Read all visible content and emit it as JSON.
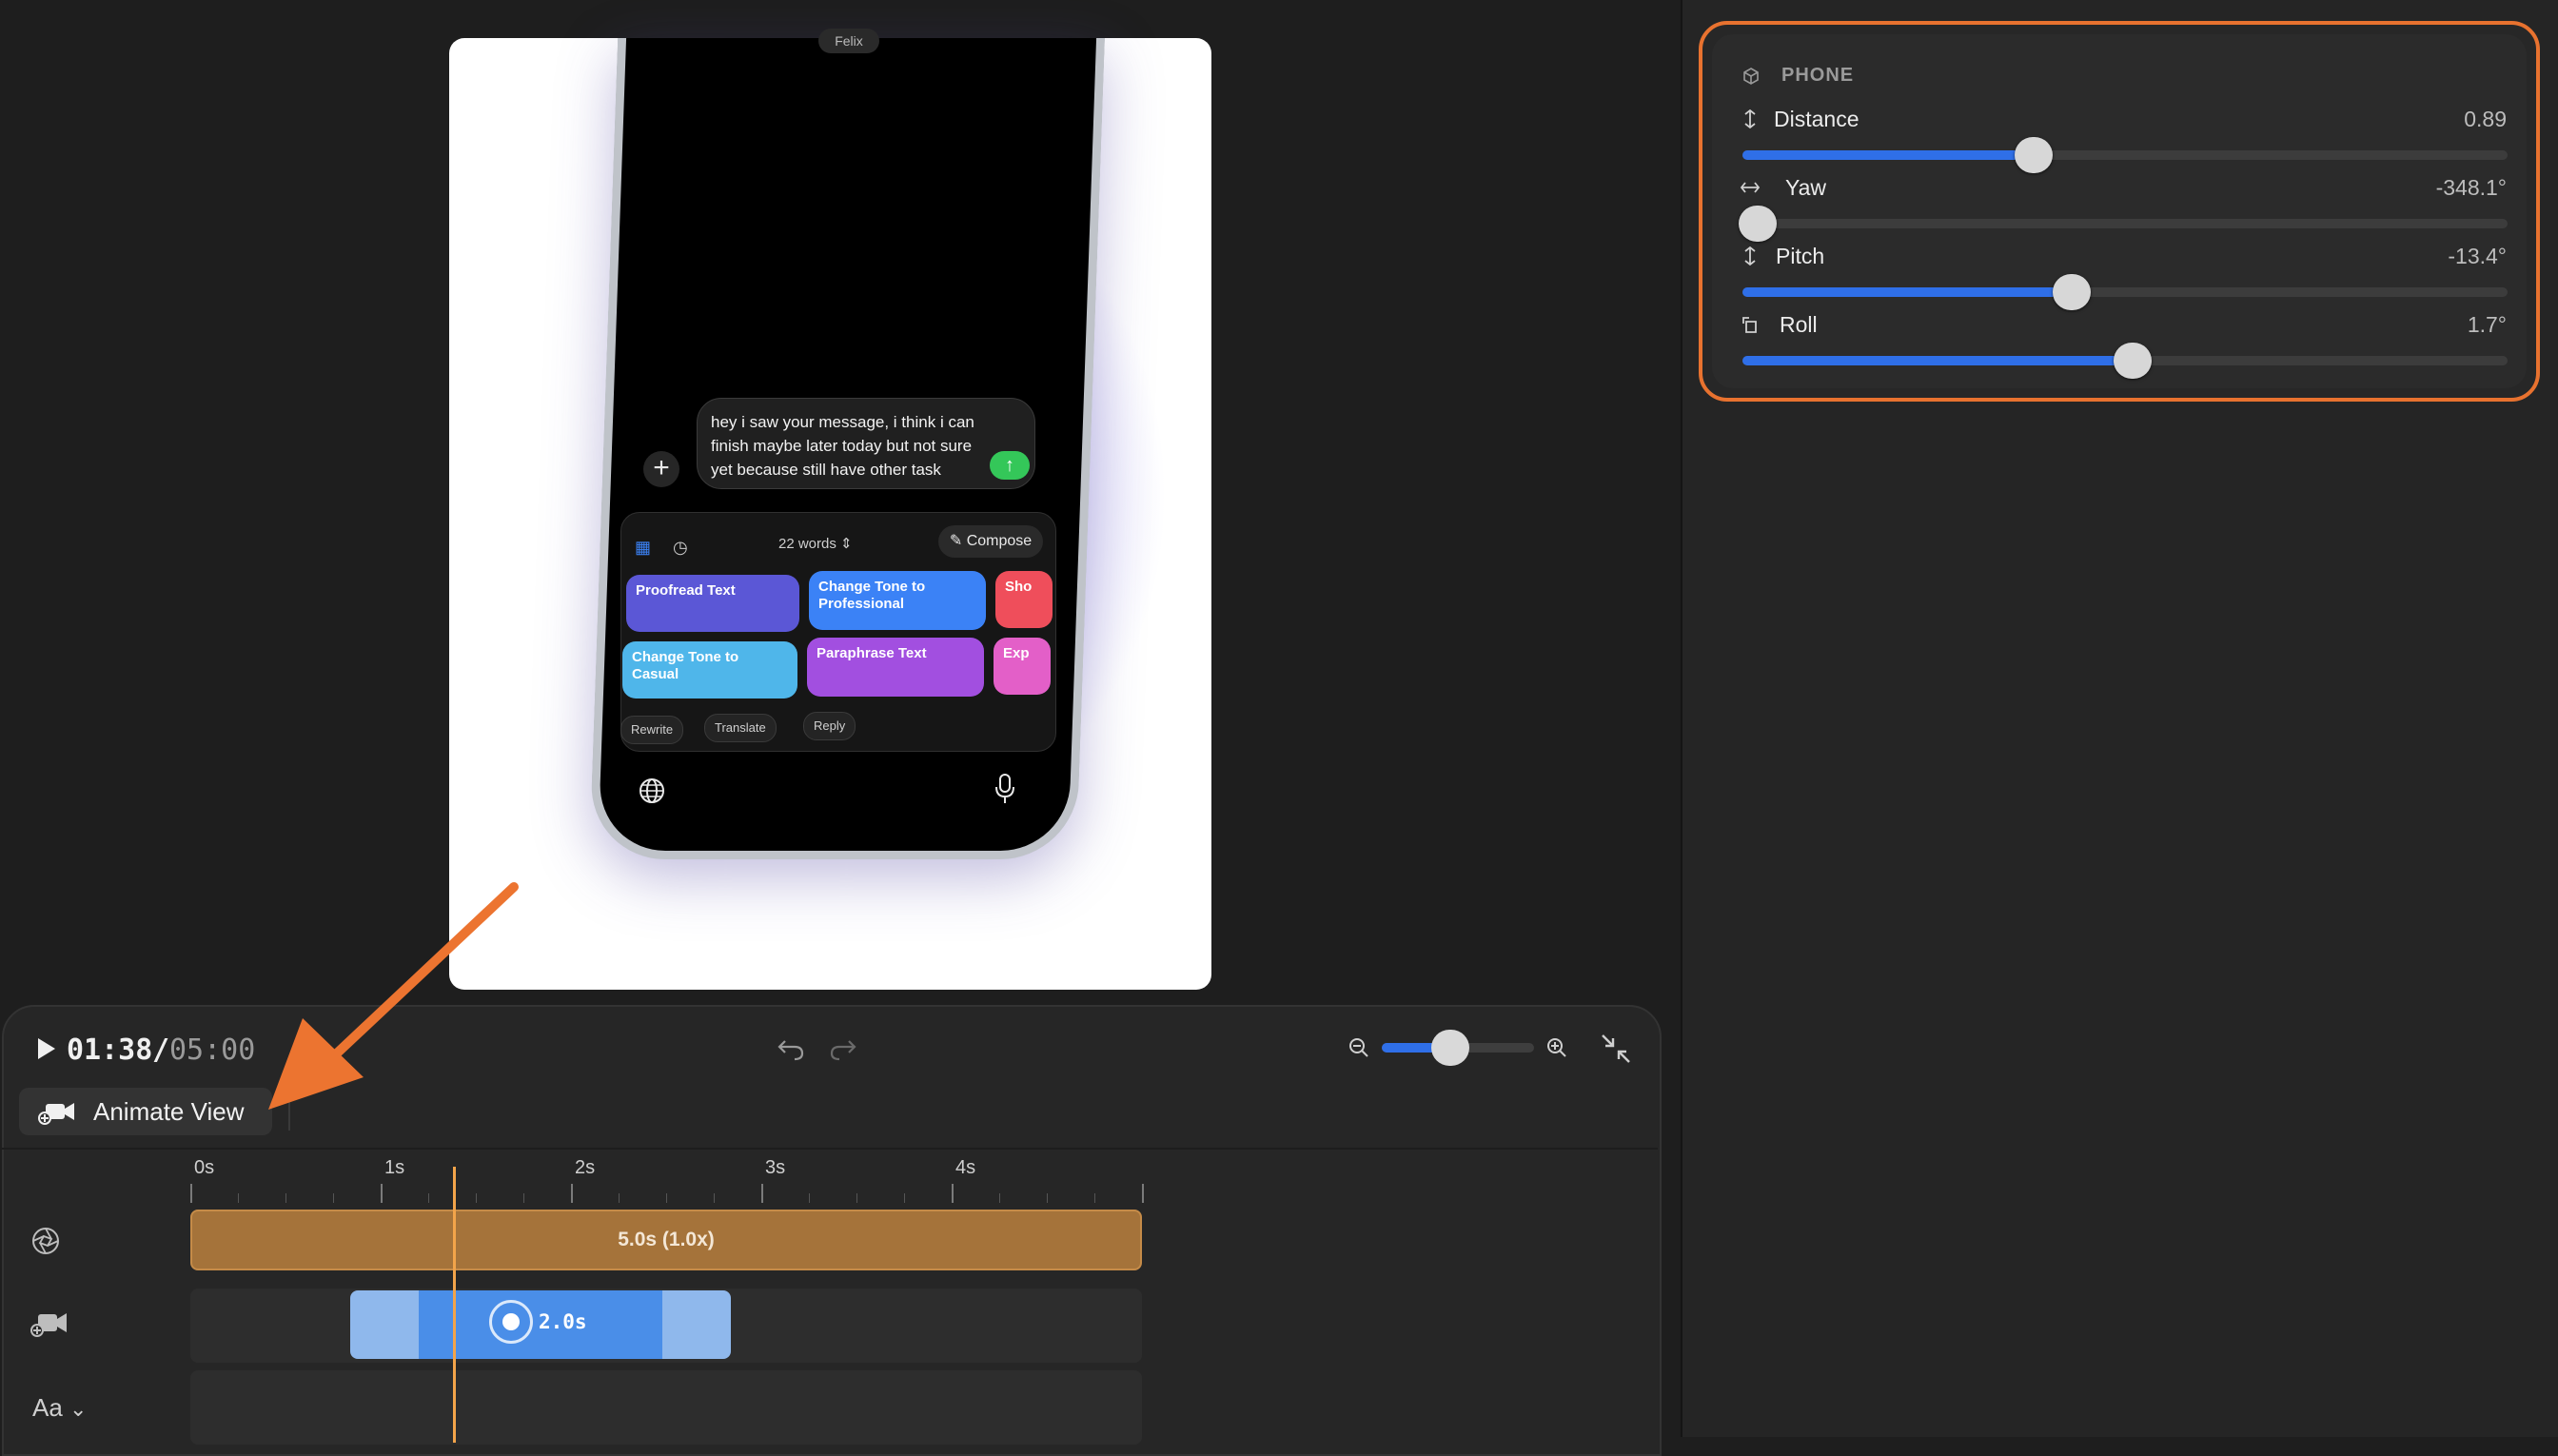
{
  "inspector": {
    "section_title": "PHONE",
    "props": [
      {
        "label": "Distance",
        "value": "0.89",
        "level": 0.38
      },
      {
        "label": "Yaw",
        "value": "-348.1°",
        "level": 0.02
      },
      {
        "label": "Pitch",
        "value": "-13.4°",
        "level": 0.43
      },
      {
        "label": "Roll",
        "value": "1.7°",
        "level": 0.51
      }
    ]
  },
  "preview": {
    "notch_label": "Felix",
    "message_text": "hey i saw your message, i think i can finish maybe later today but not sure yet because still have other task",
    "word_count": "22 words",
    "compose_label": "Compose",
    "actions": [
      {
        "label": "Proofread Text",
        "color": "#5b57d6"
      },
      {
        "label": "Change Tone to Professional",
        "color": "#3b82f6"
      },
      {
        "label": "Sho",
        "color": "#ef4e5b"
      },
      {
        "label": "Change Tone to Casual",
        "color": "#4fb6ea"
      },
      {
        "label": "Paraphrase Text",
        "color": "#a24fe0"
      },
      {
        "label": "Exp",
        "color": "#e35fc8"
      }
    ],
    "chips": [
      "Rewrite",
      "Translate",
      "Reply"
    ]
  },
  "timeline": {
    "time_current": "01:38",
    "time_separator": "/",
    "time_total": "05:00",
    "animate_button_label": "Animate View",
    "ticks": [
      "0s",
      "1s",
      "2s",
      "3s",
      "4s"
    ],
    "main_clip_label": "5.0s (1.0x)",
    "anim_clip_label": "2.0s",
    "text_track_label": "Aa",
    "zoom_level": 0.45
  },
  "colors": {
    "accent": "#2f6fe8",
    "highlight": "#e8722f",
    "clip": "#a5733a",
    "playhead": "#f3a44a"
  }
}
